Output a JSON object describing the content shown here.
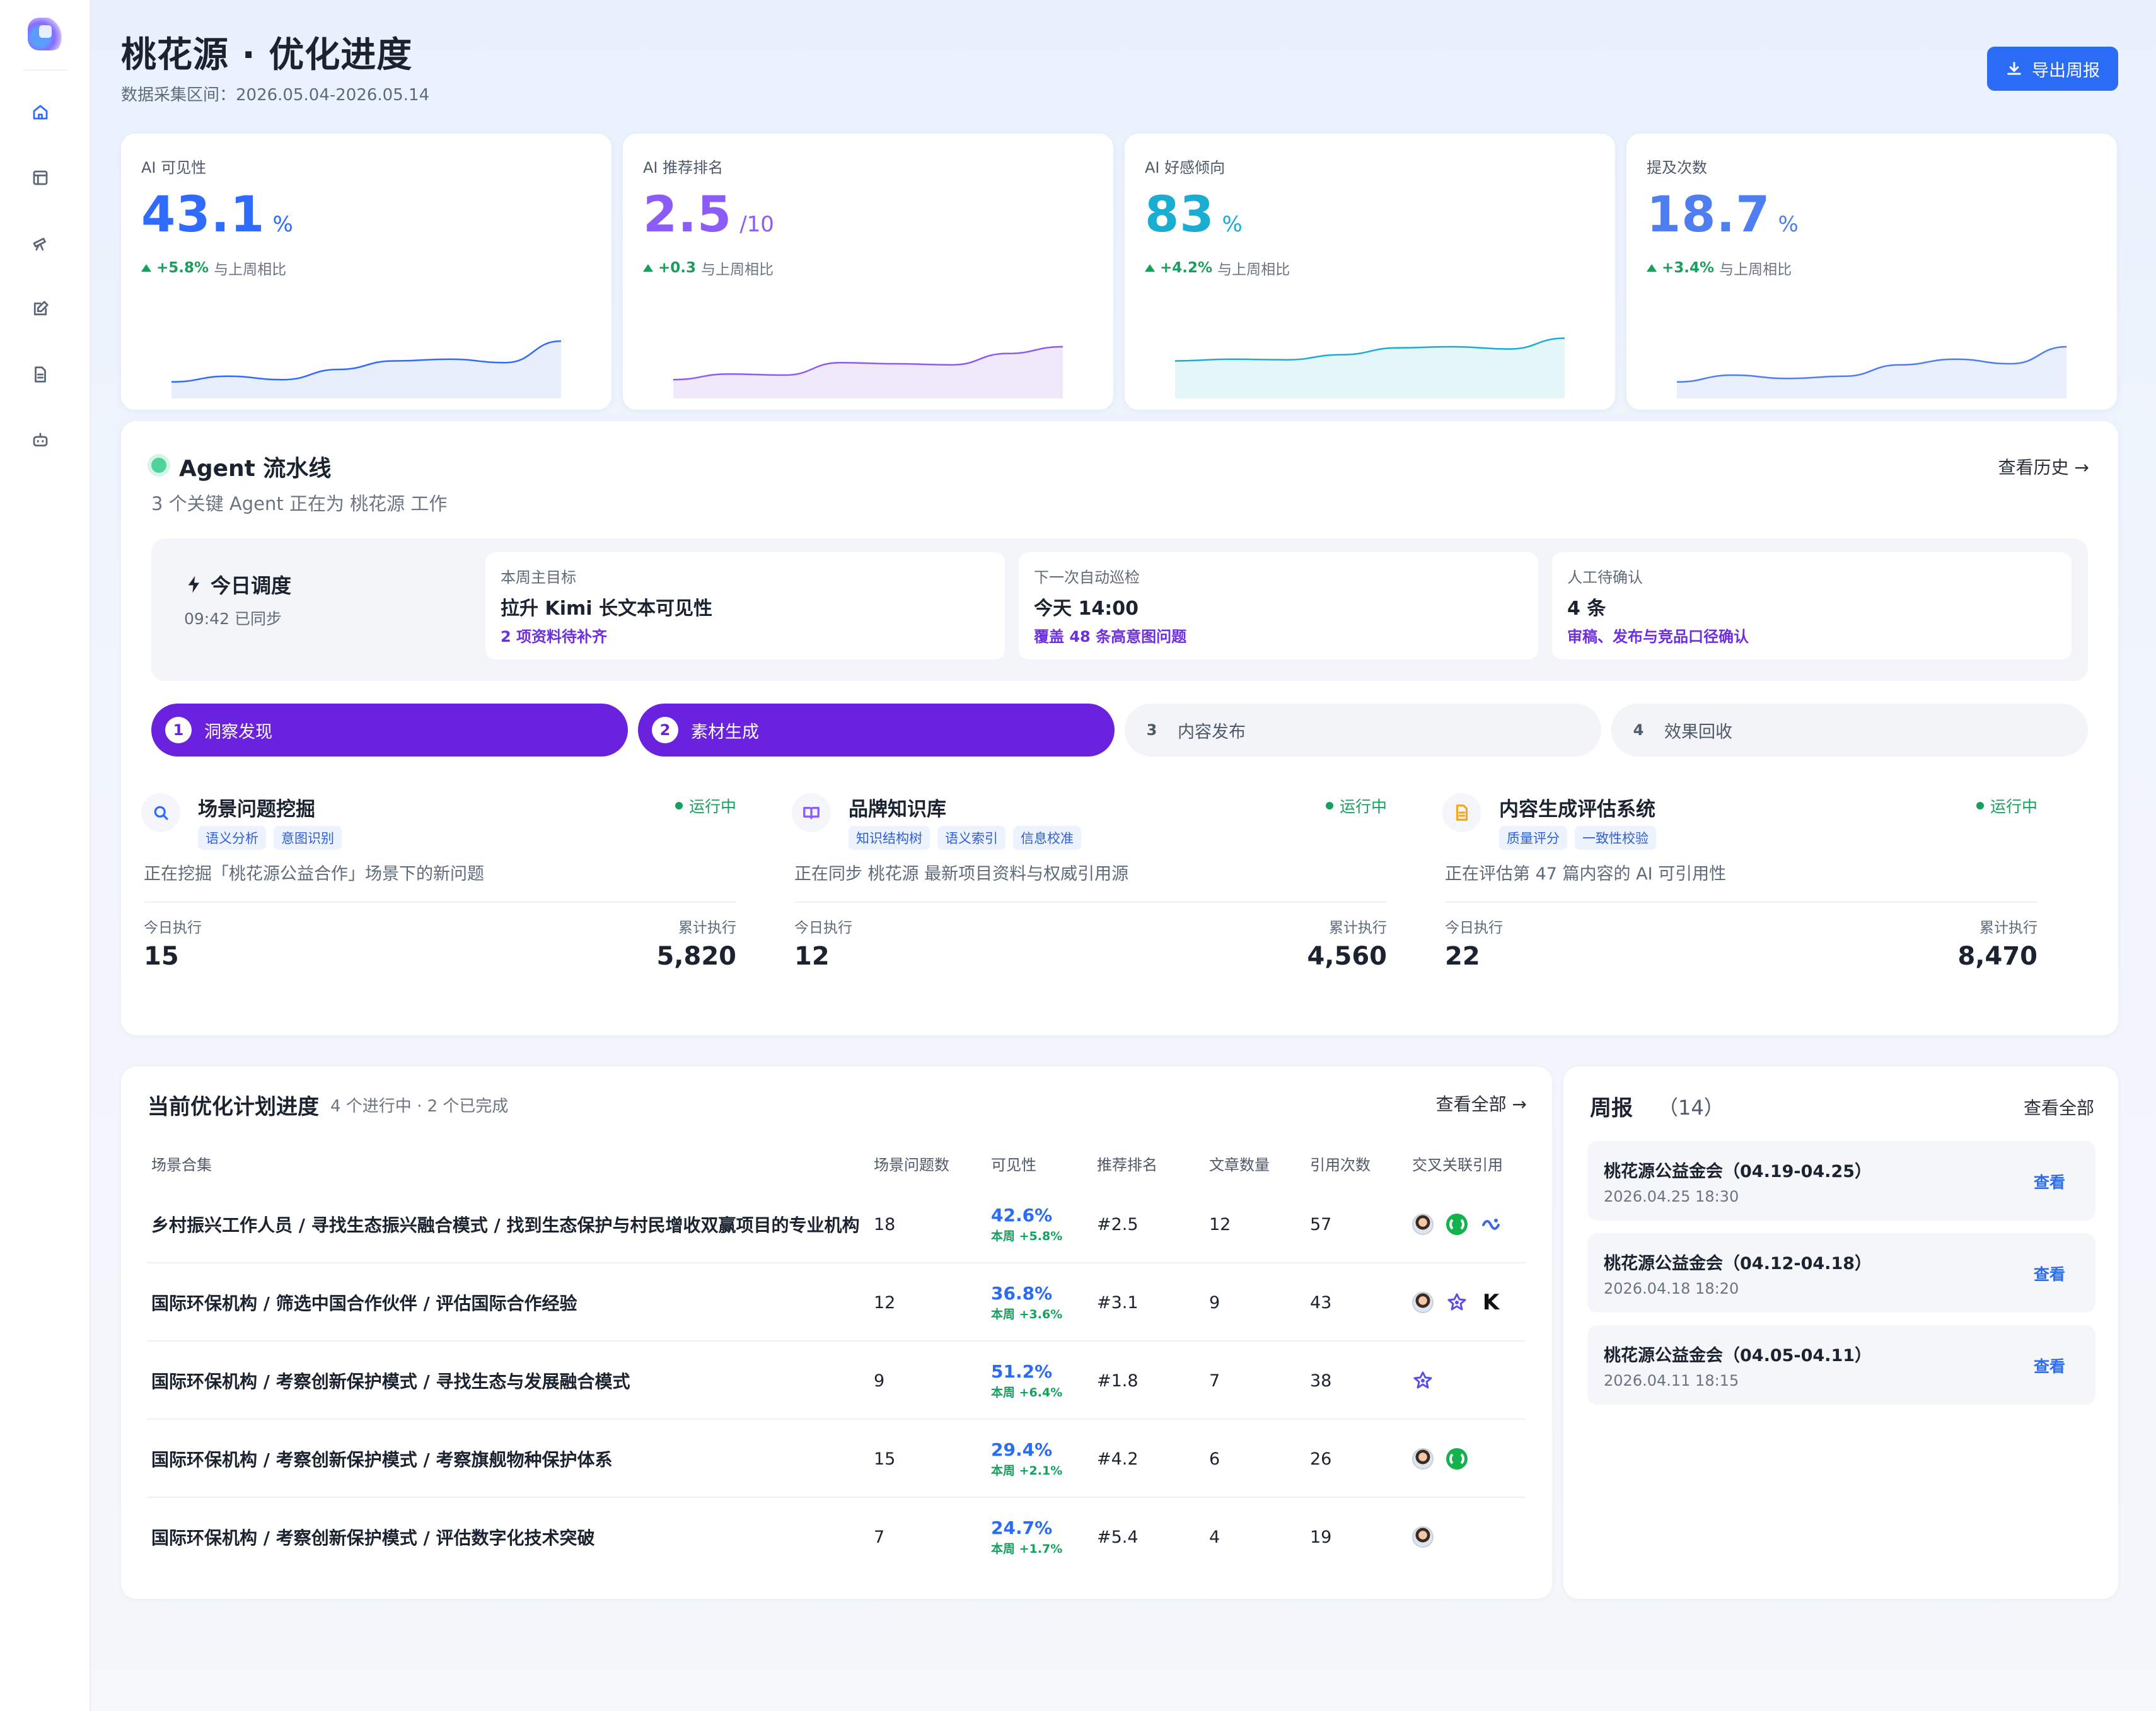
{
  "header": {
    "title": "桃花源 · 优化进度",
    "subtitle": "数据采集区间：2026.05.04-2026.05.14",
    "export_label": "导出周报"
  },
  "sidebar": {
    "items": [
      {
        "icon": "home-icon",
        "active": true
      },
      {
        "icon": "layout-icon",
        "active": false
      },
      {
        "icon": "telescope-icon",
        "active": false
      },
      {
        "icon": "edit-icon",
        "active": false
      },
      {
        "icon": "document-icon",
        "active": false
      },
      {
        "icon": "robot-icon",
        "active": false
      }
    ]
  },
  "kpis": [
    {
      "label": "AI 可见性",
      "value": "43.1",
      "unit": "%",
      "delta": "+5.8%",
      "delta_note": "与上周相比",
      "color": "#2f6bff",
      "fill": "#e8eefc",
      "trend": [
        0.18,
        0.28,
        0.22,
        0.4,
        0.55,
        0.58,
        0.52,
        0.9
      ]
    },
    {
      "label": "AI 推荐排名",
      "value": "2.5",
      "unit": "/10",
      "delta": "+0.3",
      "delta_note": "与上周相比",
      "color": "#8b5cf6",
      "fill": "#efe9fb",
      "trend": [
        0.22,
        0.32,
        0.3,
        0.52,
        0.5,
        0.48,
        0.68,
        0.8
      ]
    },
    {
      "label": "AI 好感倾向",
      "value": "83",
      "unit": "%",
      "delta": "+4.2%",
      "delta_note": "与上周相比",
      "color": "#19aed1",
      "fill": "#e5f6f9",
      "trend": [
        0.55,
        0.58,
        0.57,
        0.66,
        0.78,
        0.8,
        0.76,
        0.95
      ]
    },
    {
      "label": "提及次数",
      "value": "18.7",
      "unit": "%",
      "delta": "+3.4%",
      "delta_note": "与上周相比",
      "color": "#4f7ef2",
      "fill": "#e9effc",
      "trend": [
        0.18,
        0.3,
        0.24,
        0.28,
        0.48,
        0.58,
        0.5,
        0.8
      ]
    }
  ],
  "agent": {
    "title": "Agent 流水线",
    "subtitle": "3 个关键 Agent 正在为 桃花源 工作",
    "history_label": "查看历史 →",
    "schedule": {
      "title": "今日调度",
      "sync": "09:42 已同步",
      "cards": [
        {
          "label": "本周主目标",
          "main": "拉升 Kimi 长文本可见性",
          "note": "2 项资料待补齐"
        },
        {
          "label": "下一次自动巡检",
          "main": "今天 14:00",
          "note": "覆盖 48 条高意图问题"
        },
        {
          "label": "人工待确认",
          "main": "4 条",
          "note": "审稿、发布与竞品口径确认"
        }
      ]
    },
    "steps": [
      {
        "num": "1",
        "label": "洞察发现",
        "active": true
      },
      {
        "num": "2",
        "label": "素材生成",
        "active": true
      },
      {
        "num": "3",
        "label": "内容发布",
        "active": false
      },
      {
        "num": "4",
        "label": "效果回收",
        "active": false
      }
    ],
    "cards": [
      {
        "icon": "search-icon",
        "title": "场景问题挖掘",
        "status": "运行中",
        "tags": [
          "语义分析",
          "意图识别"
        ],
        "desc": "正在挖掘「桃花源公益合作」场景下的新问题",
        "today_label": "今日执行",
        "today": "15",
        "total_label": "累计执行",
        "total": "5,820"
      },
      {
        "icon": "book-icon",
        "title": "品牌知识库",
        "status": "运行中",
        "tags": [
          "知识结构树",
          "语义索引",
          "信息校准"
        ],
        "desc": "正在同步 桃花源 最新项目资料与权威引用源",
        "today_label": "今日执行",
        "today": "12",
        "total_label": "累计执行",
        "total": "4,560"
      },
      {
        "icon": "file-icon",
        "title": "内容生成评估系统",
        "status": "运行中",
        "tags": [
          "质量评分",
          "一致性校验"
        ],
        "desc": "正在评估第 47 篇内容的 AI 可引用性",
        "today_label": "今日执行",
        "today": "22",
        "total_label": "累计执行",
        "total": "8,470"
      }
    ]
  },
  "plan": {
    "title": "当前优化计划进度",
    "meta": "4 个进行中 · 2 个已完成",
    "view_all": "查看全部 →",
    "columns": [
      "场景合集",
      "场景问题数",
      "可见性",
      "推荐排名",
      "文章数量",
      "引用次数",
      "交叉关联引用"
    ],
    "rows": [
      {
        "name": "乡村振兴工作人员 / 寻找生态振兴融合模式 / 找到生态保护与村民增收双赢项目的专业机构",
        "questions": "18",
        "visibility": "42.6%",
        "vis_delta": "本周 +5.8%",
        "rank": "#2.5",
        "articles": "12",
        "citations": "57",
        "sources": [
          "face",
          "green",
          "wave"
        ]
      },
      {
        "name": "国际环保机构 / 筛选中国合作伙伴 / 评估国际合作经验",
        "questions": "12",
        "visibility": "36.8%",
        "vis_delta": "本周 +3.6%",
        "rank": "#3.1",
        "articles": "9",
        "citations": "43",
        "sources": [
          "face",
          "star",
          "k"
        ]
      },
      {
        "name": "国际环保机构 / 考察创新保护模式 / 寻找生态与发展融合模式",
        "questions": "9",
        "visibility": "51.2%",
        "vis_delta": "本周 +6.4%",
        "rank": "#1.8",
        "articles": "7",
        "citations": "38",
        "sources": [
          "star"
        ]
      },
      {
        "name": "国际环保机构 / 考察创新保护模式 / 考察旗舰物种保护体系",
        "questions": "15",
        "visibility": "29.4%",
        "vis_delta": "本周 +2.1%",
        "rank": "#4.2",
        "articles": "6",
        "citations": "26",
        "sources": [
          "face",
          "green"
        ]
      },
      {
        "name": "国际环保机构 / 考察创新保护模式 / 评估数字化技术突破",
        "questions": "7",
        "visibility": "24.7%",
        "vis_delta": "本周 +1.7%",
        "rank": "#5.4",
        "articles": "4",
        "citations": "19",
        "sources": [
          "face"
        ]
      }
    ]
  },
  "weekly": {
    "title": "周报",
    "count": "（14）",
    "view_all": "查看全部",
    "items": [
      {
        "name": "桃花源公益金会（04.19-04.25）",
        "date": "2026.04.25 18:30",
        "action": "查看"
      },
      {
        "name": "桃花源公益金会（04.12-04.18）",
        "date": "2026.04.18 18:20",
        "action": "查看"
      },
      {
        "name": "桃花源公益金会（04.05-04.11）",
        "date": "2026.04.11 18:15",
        "action": "查看"
      }
    ]
  }
}
